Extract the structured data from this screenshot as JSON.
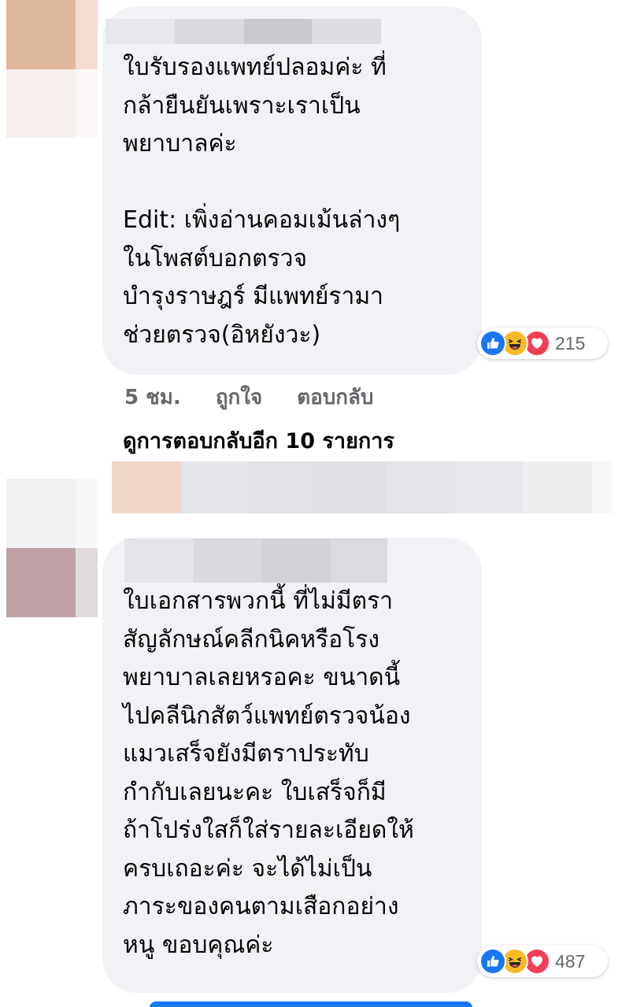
{
  "comments": [
    {
      "text": "ใบรับรองแพทย์ปลอมค่ะ ที่\nกล้ายืนยันเพราะเราเป็น\nพยาบาลค่ะ\n\nEdit: เพิ่งอ่านคอมเม้นล่างๆ\nในโพสต์บอกตรวจ\nบำรุงราษฎร์ มีแพทย์รามา\nช่วยตรวจ(อิหยังวะ)",
      "reactions": {
        "icons": [
          "like-icon",
          "haha-icon",
          "love-icon"
        ],
        "count": "215"
      },
      "actions": {
        "time": "5 ชม.",
        "like": "ถูกใจ",
        "reply": "ตอบกลับ"
      },
      "more_replies": "ดูการตอบกลับอีก 10 รายการ"
    },
    {
      "text": "ใบเอกสารพวกนี้ ที่ไม่มีตรา\nสัญลักษณ์คลีกนิคหรือโรง\nพยาบาลเลยหรอคะ ขนาดนี้\nไปคลีนิกสัตว์แพทย์ตรวจน้อง\nแมวเสร็จยังมีตราประทับ\nกำกับเลยนะคะ ใบเสร็จก็มี\nถ้าโปร่งใสก็ใส่รายละเอียดให้\nครบเถอะค่ะ จะได้ไม่เป็น\nภาระของคนตามเสือกอย่าง\nหนู ขอบคุณค่ะ",
      "reactions": {
        "icons": [
          "like-icon",
          "haha-icon",
          "love-icon"
        ],
        "count": "487"
      }
    }
  ],
  "colors": {
    "bubble": "#f0f2f5",
    "like": "#1877f2",
    "haha": "#f7b928",
    "love": "#f33e58",
    "secondary_text": "#65676b"
  }
}
